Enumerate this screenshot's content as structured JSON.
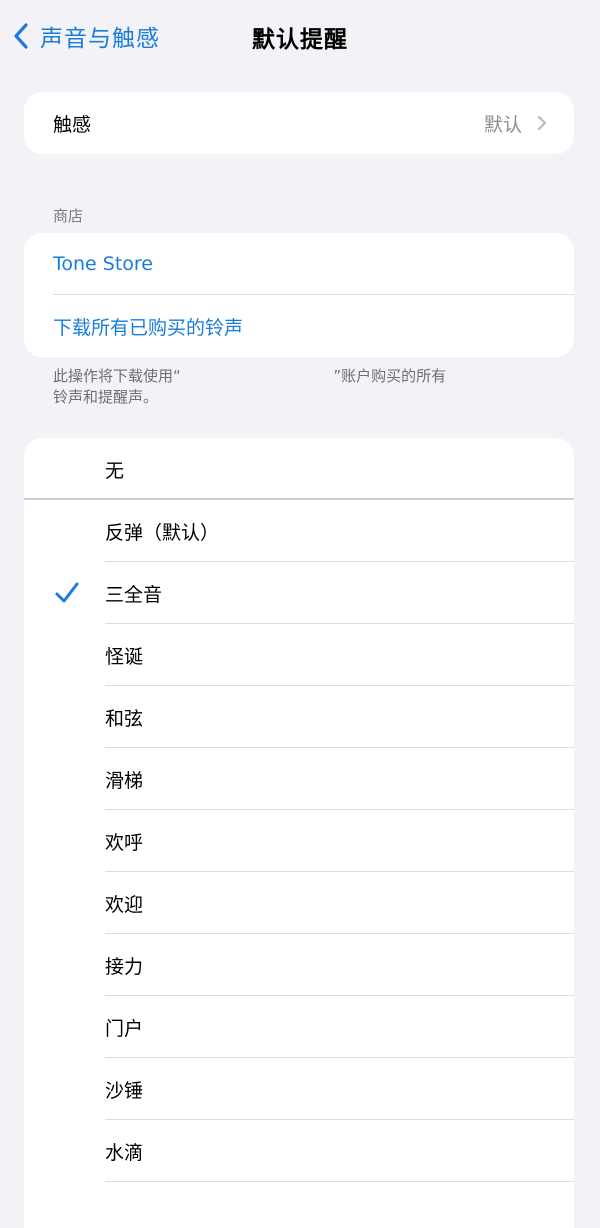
{
  "nav": {
    "back_label": "声音与触感",
    "title": "默认提醒"
  },
  "haptics": {
    "label": "触感",
    "value": "默认"
  },
  "store": {
    "header": "商店",
    "items": [
      "Tone Store",
      "下载所有已购买的铃声"
    ],
    "footnote_line1": "此操作将下载使用“                                ”账户购买的所有",
    "footnote_line2": "铃声和提醒声。"
  },
  "tones": {
    "none_label": "无",
    "items": [
      "反弹（默认）",
      "三全音",
      "怪诞",
      "和弦",
      "滑梯",
      "欢呼",
      "欢迎",
      "接力",
      "门户",
      "沙锤",
      "水滴"
    ],
    "selected": "三全音"
  },
  "colors": {
    "accent": "#1a7cdb",
    "background": "#f2f2f7"
  }
}
